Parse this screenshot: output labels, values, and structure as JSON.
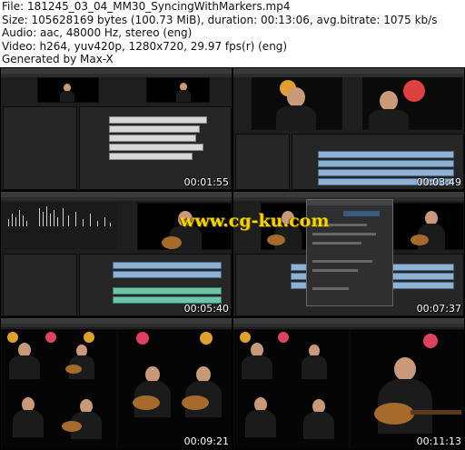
{
  "header": {
    "file_line": "File: 181245_03_04_MM30_SyncingWithMarkers.mp4",
    "size_line": "Size: 105628169 bytes (100.73 MiB), duration: 00:13:06, avg.bitrate: 1075 kb/s",
    "audio_line": "Audio: aac, 48000 Hz, stereo (eng)",
    "video_line": "Video: h264, yuv420p, 1280x720, 29.97 fps(r) (eng)",
    "generated_line": "Generated by Max-X"
  },
  "thumbnails": [
    {
      "timestamp": "00:01:55"
    },
    {
      "timestamp": "00:03:49"
    },
    {
      "timestamp": "00:05:40"
    },
    {
      "timestamp": "00:07:37"
    },
    {
      "timestamp": "00:09:21"
    },
    {
      "timestamp": "00:11:13"
    }
  ],
  "watermark": "www.cg-ku.com",
  "colors": {
    "clip_blue": "#8fb1d4",
    "clip_green": "#6cc5a8",
    "watermark_yellow": "#f5d400"
  }
}
